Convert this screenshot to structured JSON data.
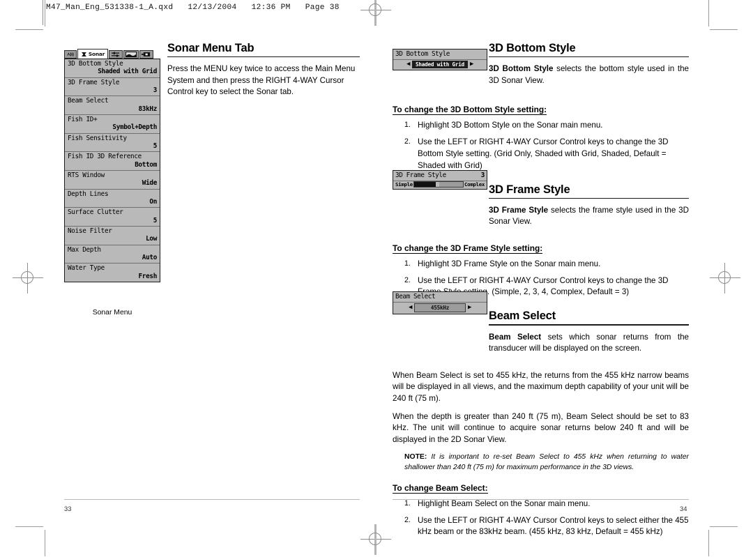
{
  "file_header": "M47_Man_Eng_531338-1_A.qxd   12/13/2004   12:36 PM   Page 38",
  "left_page": {
    "section_title": "Sonar Menu Tab",
    "intro": "Press the MENU key twice to access the Main Menu System and then press the RIGHT 4-WAY Cursor Control key to select the Sonar tab.",
    "page_number": "33",
    "sonar_menu": {
      "caption": "Sonar Menu",
      "tabs": [
        {
          "name": "alarm-tab",
          "label": "",
          "active": false
        },
        {
          "name": "sonar-tab",
          "label": "Sonar",
          "active": true
        },
        {
          "name": "setup-tab",
          "label": "",
          "active": false
        },
        {
          "name": "views-tab",
          "label": "",
          "active": false
        },
        {
          "name": "accessories-tab",
          "label": "",
          "active": false
        }
      ],
      "items": [
        {
          "label": "3D Bottom Style",
          "value": "Shaded with Grid"
        },
        {
          "label": "3D Frame Style",
          "value": "3"
        },
        {
          "label": "Beam Select",
          "value": "83kHz"
        },
        {
          "label": "Fish ID+",
          "value": "Symbol+Depth"
        },
        {
          "label": "Fish Sensitivity",
          "value": "5"
        },
        {
          "label": "Fish ID 3D Reference",
          "value": "Bottom"
        },
        {
          "label": "RTS Window",
          "value": "Wide"
        },
        {
          "label": "Depth Lines",
          "value": "On"
        },
        {
          "label": "Surface Clutter",
          "value": "5"
        },
        {
          "label": "Noise Filter",
          "value": "Low"
        },
        {
          "label": "Max Depth",
          "value": "Auto"
        },
        {
          "label": "Water Type",
          "value": "Fresh"
        }
      ]
    }
  },
  "right_page": {
    "page_number": "34",
    "sections": [
      {
        "title": "3D Bottom Style",
        "widget": {
          "type": "arrows",
          "title": "3D Bottom Style",
          "value": "Shaded with Grid",
          "left_arrow": "◀",
          "right_arrow": "▶"
        },
        "description_bold": "3D Bottom Style",
        "description_rest": " selects the bottom style used in the 3D Sonar View.",
        "howto_title": "To change the 3D Bottom Style setting:",
        "steps": [
          "Highlight 3D Bottom Style on the Sonar main menu.",
          "Use the LEFT or RIGHT 4-WAY Cursor Control keys to change the 3D Bottom Style setting. (Grid Only, Shaded with Grid, Shaded, Default = Shaded with Grid)"
        ]
      },
      {
        "title": "3D Frame Style",
        "widget": {
          "type": "slider",
          "title": "3D Frame Style",
          "number": "3",
          "min_label": "Simple",
          "max_label": "Complex"
        },
        "description_bold": "3D Frame Style",
        "description_rest": " selects the frame style used in the 3D Sonar View.",
        "howto_title": "To change the 3D Frame Style setting:",
        "steps": [
          "Highlight 3D Frame Style on the Sonar main menu.",
          "Use the LEFT or RIGHT 4-WAY Cursor Control keys to change the 3D Frame Style setting. (Simple, 2, 3, 4, Complex, Default = 3)"
        ]
      },
      {
        "title": "Beam Select",
        "widget": {
          "type": "arrows-gray",
          "title": "Beam Select",
          "value": "455kHz",
          "left_arrow": "◀",
          "right_arrow": "▶"
        },
        "description_bold": "Beam Select",
        "description_rest": " sets which sonar returns from the transducer will be displayed on the screen.",
        "paragraphs": [
          "When Beam Select is set to 455 kHz, the returns from the 455 kHz narrow beams will be displayed in all views, and the maximum depth capability of your unit will be 240 ft (75 m).",
          "When the depth is greater than 240 ft (75 m), Beam Select should be set to 83 kHz. The unit will continue to acquire sonar returns below 240 ft and will be displayed in the 2D Sonar View."
        ],
        "note_label": "NOTE:",
        "note_text": "It is important to re-set Beam Select to 455 kHz when returning to water shallower than 240 ft (75 m) for maximum performance in the 3D views.",
        "howto_title": "To change Beam Select:",
        "steps": [
          "Highlight Beam Select on the Sonar main menu.",
          "Use the LEFT or RIGHT 4-WAY Cursor Control keys to select either the 455 kHz beam or the 83kHz beam. (455 kHz, 83 kHz, Default = 455 kHz)"
        ]
      }
    ]
  }
}
